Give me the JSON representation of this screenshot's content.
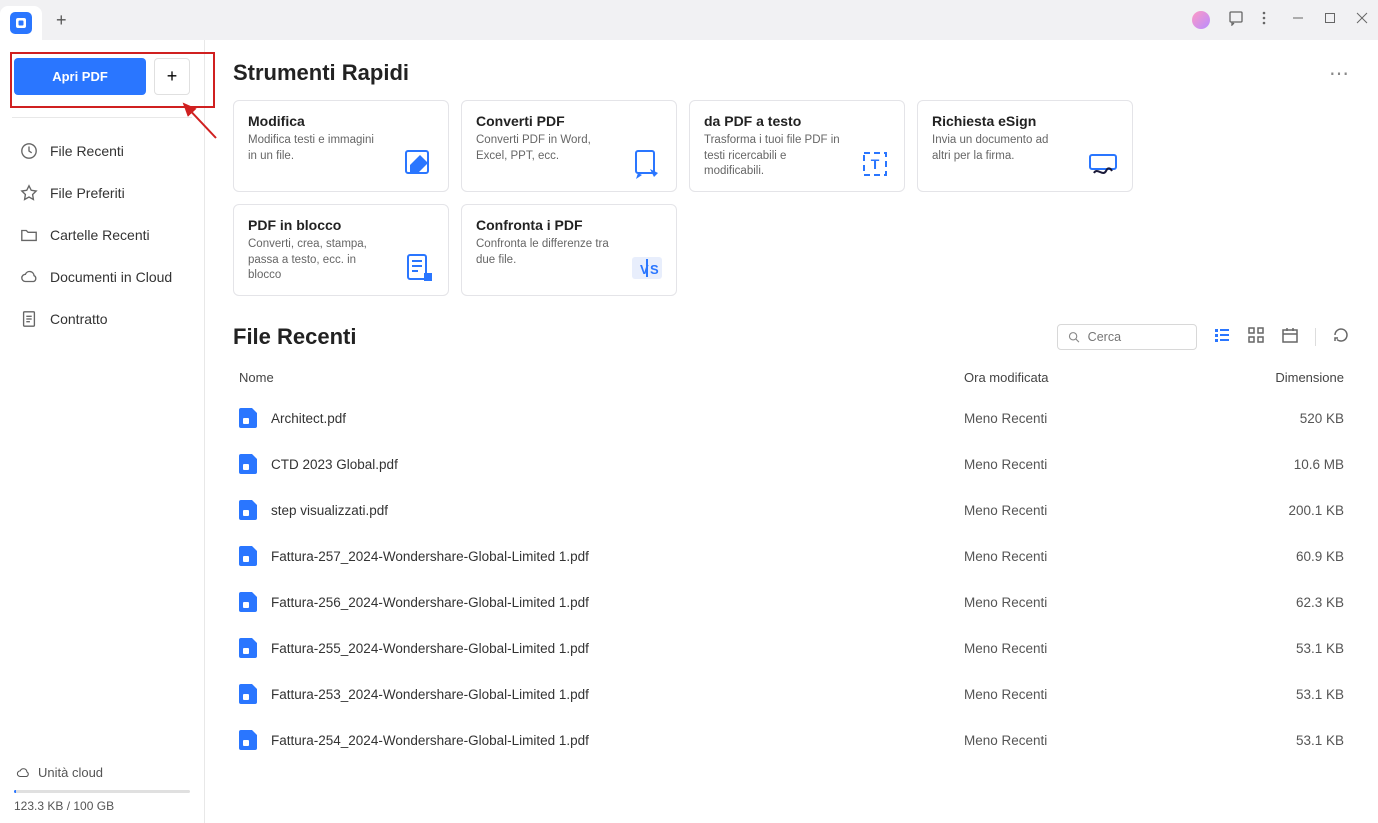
{
  "titlebar": {
    "new_tab": "+"
  },
  "sidebar": {
    "open_label": "Apri PDF",
    "plus": "+",
    "nav": [
      {
        "label": "File Recenti"
      },
      {
        "label": "File Preferiti"
      },
      {
        "label": "Cartelle Recenti"
      },
      {
        "label": "Documenti in Cloud"
      },
      {
        "label": "Contratto"
      }
    ],
    "cloud_label": "Unità cloud",
    "storage": "123.3 KB / 100 GB"
  },
  "quick_tools": {
    "title": "Strumenti Rapidi",
    "more": "⋯",
    "cards": [
      {
        "title": "Modifica",
        "desc": "Modifica testi e immagini in un file."
      },
      {
        "title": "Converti PDF",
        "desc": "Converti PDF in Word, Excel, PPT, ecc."
      },
      {
        "title": "da PDF a testo",
        "desc": "Trasforma i tuoi file PDF in testi ricercabili e modificabili."
      },
      {
        "title": "Richiesta eSign",
        "desc": "Invia un documento ad altri per la firma."
      },
      {
        "title": "PDF in blocco",
        "desc": "Converti, crea, stampa, passa a testo, ecc. in blocco"
      },
      {
        "title": "Confronta i PDF",
        "desc": "Confronta le differenze tra due file."
      }
    ]
  },
  "recent": {
    "title": "File Recenti",
    "search_placeholder": "Cerca",
    "cols": {
      "name": "Nome",
      "date": "Ora modificata",
      "size": "Dimensione"
    },
    "files": [
      {
        "name": "Architect.pdf",
        "date": "Meno Recenti",
        "size": "520 KB"
      },
      {
        "name": "CTD 2023 Global.pdf",
        "date": "Meno Recenti",
        "size": "10.6 MB"
      },
      {
        "name": "step visualizzati.pdf",
        "date": "Meno Recenti",
        "size": "200.1 KB"
      },
      {
        "name": "Fattura-257_2024-Wondershare-Global-Limited 1.pdf",
        "date": "Meno Recenti",
        "size": "60.9 KB"
      },
      {
        "name": "Fattura-256_2024-Wondershare-Global-Limited 1.pdf",
        "date": "Meno Recenti",
        "size": "62.3 KB"
      },
      {
        "name": "Fattura-255_2024-Wondershare-Global-Limited 1.pdf",
        "date": "Meno Recenti",
        "size": "53.1 KB"
      },
      {
        "name": "Fattura-253_2024-Wondershare-Global-Limited 1.pdf",
        "date": "Meno Recenti",
        "size": "53.1 KB"
      },
      {
        "name": "Fattura-254_2024-Wondershare-Global-Limited 1.pdf",
        "date": "Meno Recenti",
        "size": "53.1 KB"
      }
    ]
  }
}
